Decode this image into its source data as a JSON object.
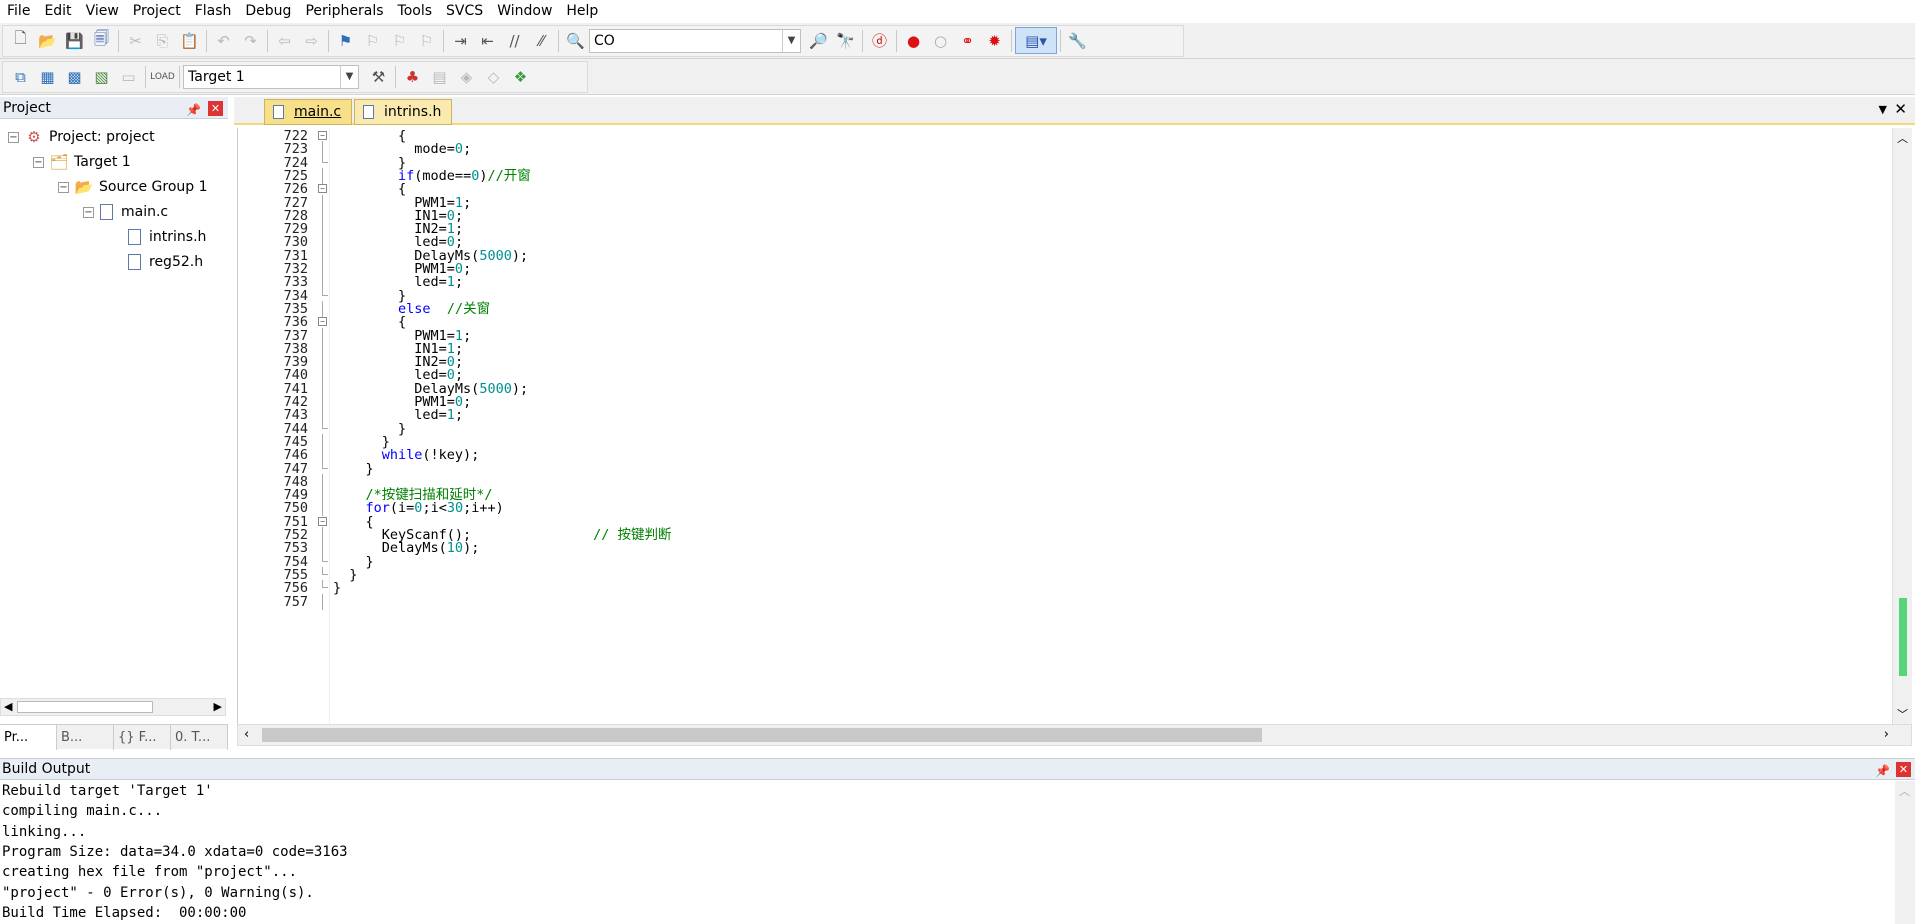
{
  "menu": [
    "File",
    "Edit",
    "View",
    "Project",
    "Flash",
    "Debug",
    "Peripherals",
    "Tools",
    "SVCS",
    "Window",
    "Help"
  ],
  "toolbar": {
    "find_value": "CO",
    "target_select": "Target 1"
  },
  "project_panel": {
    "title": "Project",
    "tree": {
      "root": "Project: project",
      "target": "Target 1",
      "group": "Source Group 1",
      "file": "main.c",
      "includes": [
        "intrins.h",
        "reg52.h"
      ]
    },
    "tabs": [
      "Pr...",
      "B...",
      "{} F...",
      "0. T..."
    ]
  },
  "editor_tabs": [
    "main.c",
    "intrins.h"
  ],
  "code_lines": [
    {
      "n": "722",
      "t": "        {"
    },
    {
      "n": "723",
      "t": "          mode=0;"
    },
    {
      "n": "724",
      "t": "        }"
    },
    {
      "n": "725",
      "t": "        if(mode==0)//开窗"
    },
    {
      "n": "726",
      "t": "        {"
    },
    {
      "n": "727",
      "t": "          PWM1=1;"
    },
    {
      "n": "728",
      "t": "          IN1=0;"
    },
    {
      "n": "729",
      "t": "          IN2=1;"
    },
    {
      "n": "730",
      "t": "          led=0;"
    },
    {
      "n": "731",
      "t": "          DelayMs(5000);"
    },
    {
      "n": "732",
      "t": "          PWM1=0;"
    },
    {
      "n": "733",
      "t": "          led=1;"
    },
    {
      "n": "734",
      "t": "        }"
    },
    {
      "n": "735",
      "t": "        else  //关窗"
    },
    {
      "n": "736",
      "t": "        {"
    },
    {
      "n": "737",
      "t": "          PWM1=1;"
    },
    {
      "n": "738",
      "t": "          IN1=1;"
    },
    {
      "n": "739",
      "t": "          IN2=0;"
    },
    {
      "n": "740",
      "t": "          led=0;"
    },
    {
      "n": "741",
      "t": "          DelayMs(5000);"
    },
    {
      "n": "742",
      "t": "          PWM1=0;"
    },
    {
      "n": "743",
      "t": "          led=1;"
    },
    {
      "n": "744",
      "t": "        }"
    },
    {
      "n": "745",
      "t": "      }"
    },
    {
      "n": "746",
      "t": "      while(!key);"
    },
    {
      "n": "747",
      "t": "    }"
    },
    {
      "n": "748",
      "t": ""
    },
    {
      "n": "749",
      "t": "    /*按键扫描和延时*/"
    },
    {
      "n": "750",
      "t": "    for(i=0;i<30;i++)"
    },
    {
      "n": "751",
      "t": "    {"
    },
    {
      "n": "752",
      "t": "      KeyScanf();               // 按键判断"
    },
    {
      "n": "753",
      "t": "      DelayMs(10);"
    },
    {
      "n": "754",
      "t": "    }"
    },
    {
      "n": "755",
      "t": "  }"
    },
    {
      "n": "756",
      "t": "}"
    },
    {
      "n": "757",
      "t": ""
    }
  ],
  "build_output": {
    "title": "Build Output",
    "lines": [
      "Rebuild target 'Target 1'",
      "compiling main.c...",
      "linking...",
      "Program Size: data=34.0 xdata=0 code=3163",
      "creating hex file from \"project\"...",
      "\"project\" - 0 Error(s), 0 Warning(s).",
      "Build Time Elapsed:  00:00:00"
    ]
  }
}
